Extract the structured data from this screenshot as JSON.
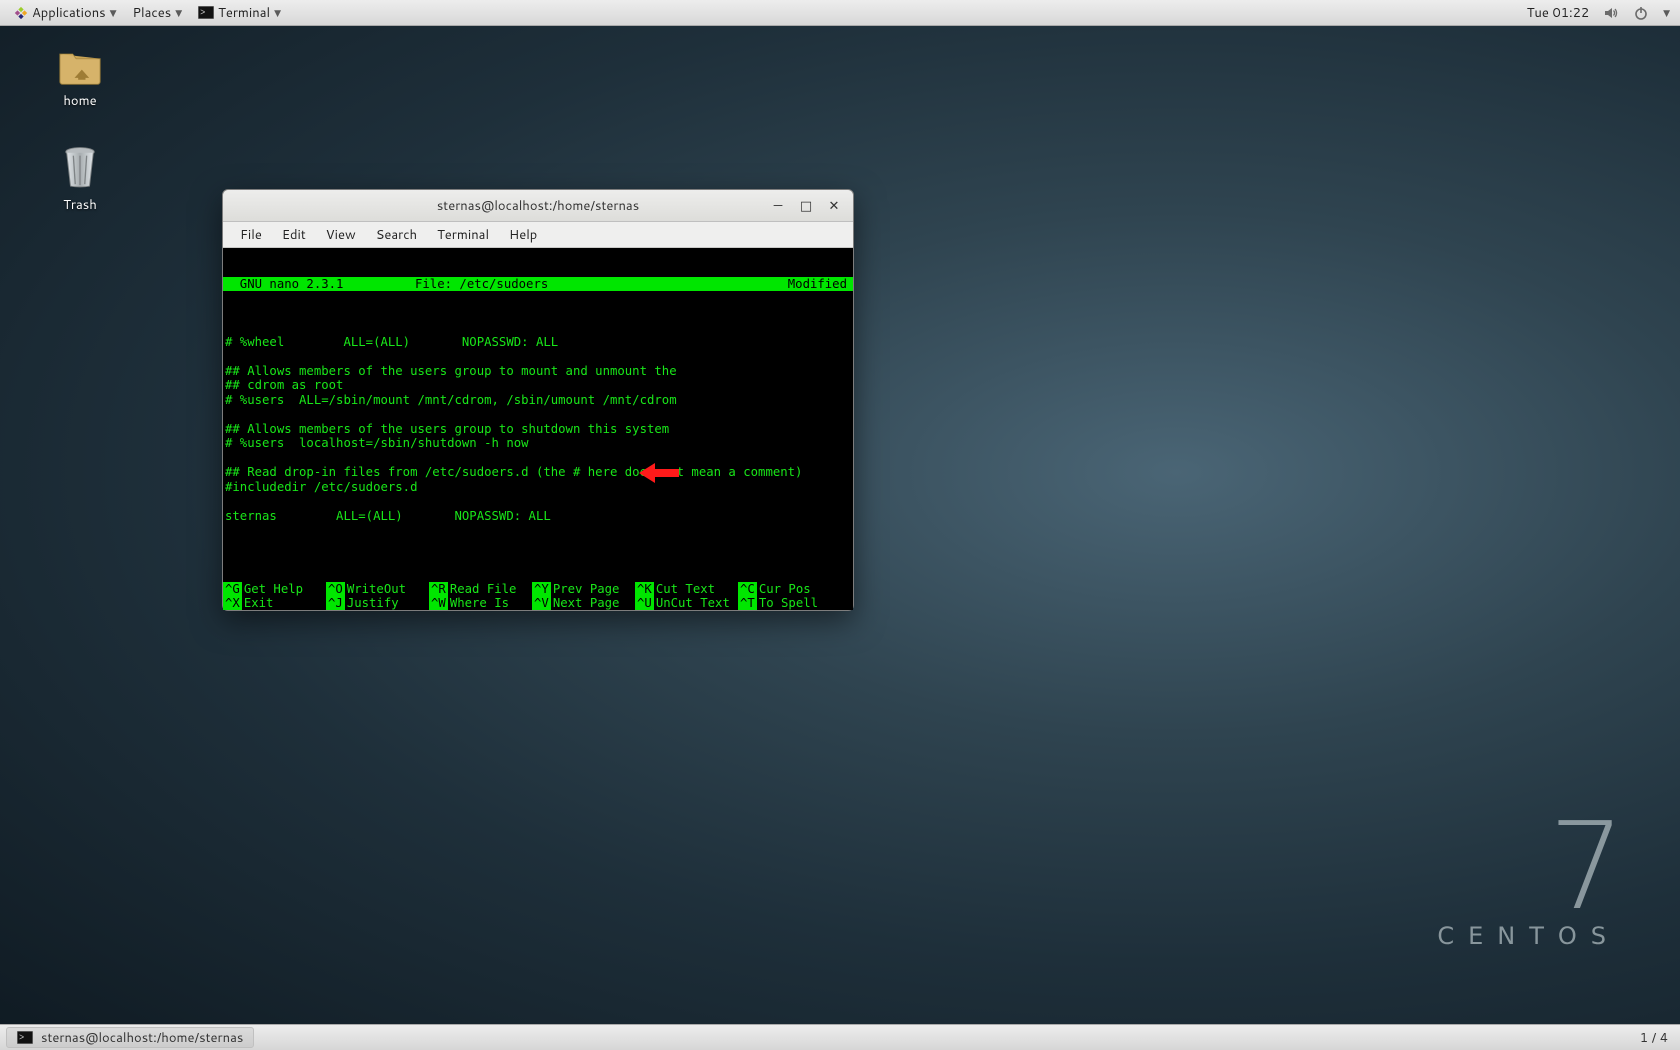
{
  "top_panel": {
    "applications": "Applications",
    "places": "Places",
    "terminal": "Terminal",
    "clock": "Tue 01:22"
  },
  "desktop": {
    "home_label": "home",
    "trash_label": "Trash"
  },
  "watermark": {
    "seven": "7",
    "name": "CENTOS"
  },
  "window": {
    "title": "sternas@localhost:/home/sternas",
    "menus": [
      "File",
      "Edit",
      "View",
      "Search",
      "Terminal",
      "Help"
    ]
  },
  "nano": {
    "app": "  GNU nano 2.3.1",
    "file_label": "File: /etc/sudoers",
    "modified": "Modified",
    "content": "\n# %wheel        ALL=(ALL)       NOPASSWD: ALL\n\n## Allows members of the users group to mount and unmount the\n## cdrom as root\n# %users  ALL=/sbin/mount /mnt/cdrom, /sbin/umount /mnt/cdrom\n\n## Allows members of the users group to shutdown this system\n# %users  localhost=/sbin/shutdown -h now\n\n## Read drop-in files from /etc/sudoers.d (the # here does not mean a comment)\n#includedir /etc/sudoers.d\n\nsternas        ALL=(ALL)       NOPASSWD: ALL",
    "footer": [
      [
        {
          "k": "^G",
          "l": "Get Help"
        },
        {
          "k": "^O",
          "l": "WriteOut"
        },
        {
          "k": "^R",
          "l": "Read File"
        },
        {
          "k": "^Y",
          "l": "Prev Page"
        },
        {
          "k": "^K",
          "l": "Cut Text"
        },
        {
          "k": "^C",
          "l": "Cur Pos"
        }
      ],
      [
        {
          "k": "^X",
          "l": "Exit"
        },
        {
          "k": "^J",
          "l": "Justify"
        },
        {
          "k": "^W",
          "l": "Where Is"
        },
        {
          "k": "^V",
          "l": "Next Page"
        },
        {
          "k": "^U",
          "l": "UnCut Text"
        },
        {
          "k": "^T",
          "l": "To Spell"
        }
      ]
    ]
  },
  "bottom_panel": {
    "task_label": "sternas@localhost:/home/sternas",
    "workspace": "1 / 4"
  }
}
